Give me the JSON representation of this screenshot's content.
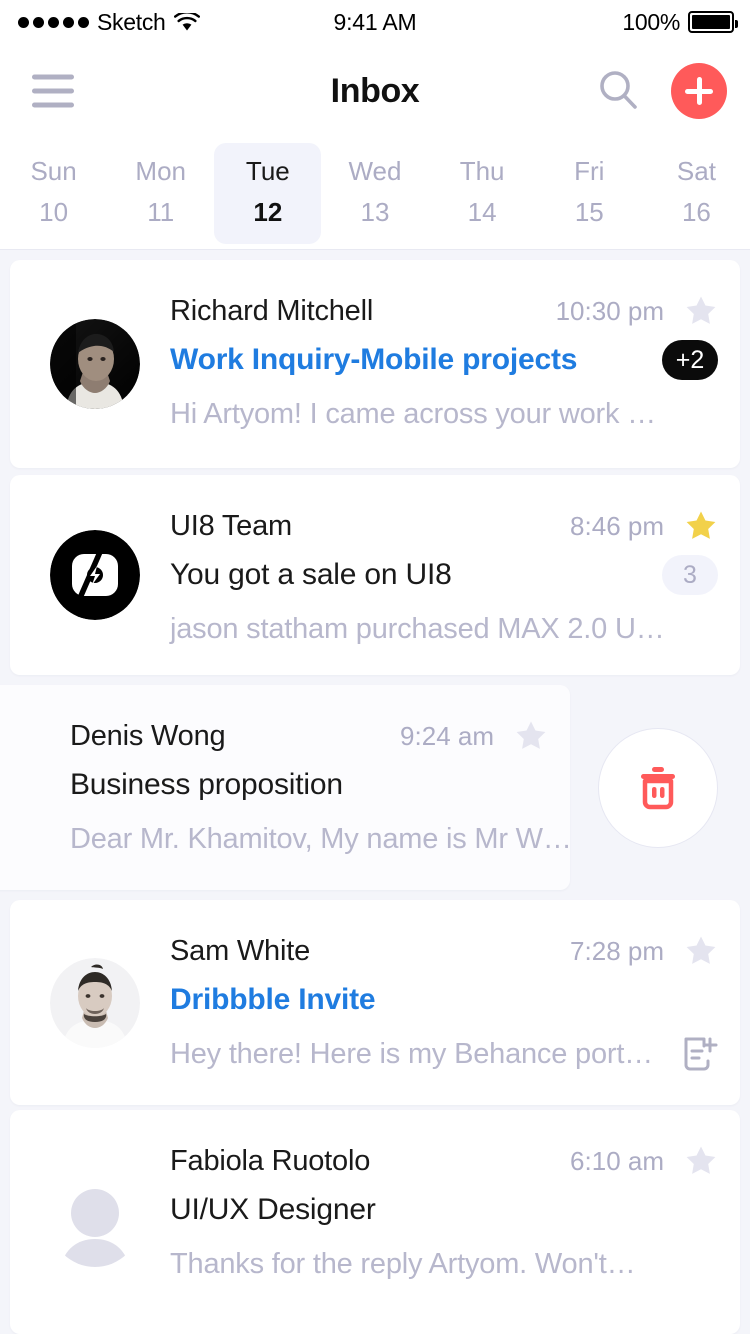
{
  "status_bar": {
    "carrier": "Sketch",
    "signal_dots": 5,
    "wifi_icon": "wifi-icon",
    "time": "9:41 AM",
    "battery_percent": "100%"
  },
  "nav": {
    "menu_icon": "hamburger-menu-icon",
    "title": "Inbox",
    "search_icon": "search-icon",
    "compose_icon": "plus-icon",
    "accent_color": "#FF5A5A"
  },
  "week_strip": {
    "days": [
      {
        "dow": "Sun",
        "num": "10",
        "active": false
      },
      {
        "dow": "Mon",
        "num": "11",
        "active": false
      },
      {
        "dow": "Tue",
        "num": "12",
        "active": true
      },
      {
        "dow": "Wed",
        "num": "13",
        "active": false
      },
      {
        "dow": "Thu",
        "num": "14",
        "active": false
      },
      {
        "dow": "Fri",
        "num": "15",
        "active": false
      },
      {
        "dow": "Sat",
        "num": "16",
        "active": false
      }
    ]
  },
  "emails": [
    {
      "sender": "Richard Mitchell",
      "time": "10:30 pm",
      "subject": "Work Inquiry-Mobile projects",
      "preview": "Hi Artyom! I came across your work …",
      "badge": "+2",
      "badge_style": "dark",
      "starred": false,
      "subject_link": true,
      "avatar_type": "photo-dark",
      "star_icon": "star-icon"
    },
    {
      "sender": "UI8 Team",
      "time": "8:46 pm",
      "subject": "You got a sale on UI8",
      "preview": "jason statham purchased MAX 2.0 U…",
      "badge": "3",
      "badge_style": "light",
      "starred": true,
      "subject_link": false,
      "avatar_type": "ui8-logo",
      "star_icon": "star-icon"
    },
    {
      "sender": "Denis Wong",
      "time": "9:24 am",
      "subject": "Business proposition",
      "preview": "Dear Mr. Khamitov, My name is Mr W…",
      "badge": "",
      "badge_style": "none",
      "starred": false,
      "subject_link": false,
      "avatar_type": "hidden",
      "swiped": true,
      "star_icon": "star-icon",
      "action_icon": "trash-icon",
      "action_color": "#FF5A5A"
    },
    {
      "sender": "Sam White",
      "time": "7:28 pm",
      "subject": "Dribbble Invite",
      "preview": "Hey there! Here is my Behance port…",
      "badge": "",
      "badge_style": "none",
      "starred": false,
      "subject_link": true,
      "avatar_type": "photo-light",
      "star_icon": "star-icon",
      "draft_icon": "draft-note-add-icon"
    },
    {
      "sender": "Fabiola Ruotolo",
      "time": "6:10 am",
      "subject": "UI/UX Designer",
      "preview": "Thanks for the reply Artyom. Won't…",
      "badge": "",
      "badge_style": "none",
      "starred": false,
      "subject_link": false,
      "avatar_type": "placeholder",
      "star_icon": "star-icon"
    }
  ]
}
